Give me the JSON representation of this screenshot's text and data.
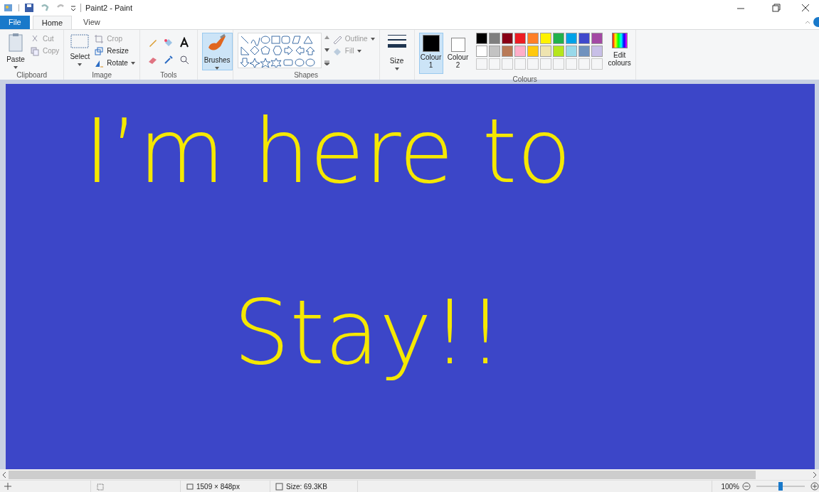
{
  "window": {
    "title": "Paint2 - Paint"
  },
  "tabs": [
    {
      "label": "File",
      "kind": "file",
      "selected": false
    },
    {
      "label": "Home",
      "kind": "tab",
      "selected": true
    },
    {
      "label": "View",
      "kind": "tab",
      "selected": false
    }
  ],
  "ribbon": {
    "clipboard": {
      "label": "Clipboard",
      "paste": "Paste",
      "cut": "Cut",
      "copy": "Copy"
    },
    "image": {
      "label": "Image",
      "select": "Select",
      "crop": "Crop",
      "resize": "Resize",
      "rotate": "Rotate"
    },
    "tools": {
      "label": "Tools"
    },
    "brushes": {
      "label": "Brushes",
      "selected": true
    },
    "shapes": {
      "label": "Shapes",
      "outline": "Outline",
      "fill": "Fill"
    },
    "size": {
      "label": "Size"
    },
    "colours": {
      "label": "Colours",
      "colour1": {
        "label": "Colour",
        "number": "1",
        "color": "#000000",
        "selected": true
      },
      "colour2": {
        "label": "Colour",
        "number": "2",
        "color": "#ffffff",
        "selected": false
      },
      "palette": [
        {
          "color": "#000000"
        },
        {
          "color": "#7f7f7f"
        },
        {
          "color": "#880015"
        },
        {
          "color": "#ed1c24"
        },
        {
          "color": "#ff7f27"
        },
        {
          "color": "#fff200"
        },
        {
          "color": "#22b14c"
        },
        {
          "color": "#00a2e8"
        },
        {
          "color": "#3f48cc"
        },
        {
          "color": "#a349a4"
        },
        {
          "color": "#ffffff"
        },
        {
          "color": "#c3c3c3"
        },
        {
          "color": "#b97a57"
        },
        {
          "color": "#ffaec9"
        },
        {
          "color": "#ffc90e"
        },
        {
          "color": "#efe4b0"
        },
        {
          "color": "#b5e61d"
        },
        {
          "color": "#99d9ea"
        },
        {
          "color": "#7092be"
        },
        {
          "color": "#c8bfe7"
        }
      ],
      "edit": [
        "Edit",
        "colours"
      ]
    }
  },
  "canvas": {
    "lines": [
      "I’m here to",
      "Stay!!"
    ]
  },
  "status_bar": {
    "dimensions": "1509 × 848px",
    "size": "Size: 69.3KB",
    "zoom": "100%",
    "zoom_slider": {
      "level": 0.5
    }
  }
}
